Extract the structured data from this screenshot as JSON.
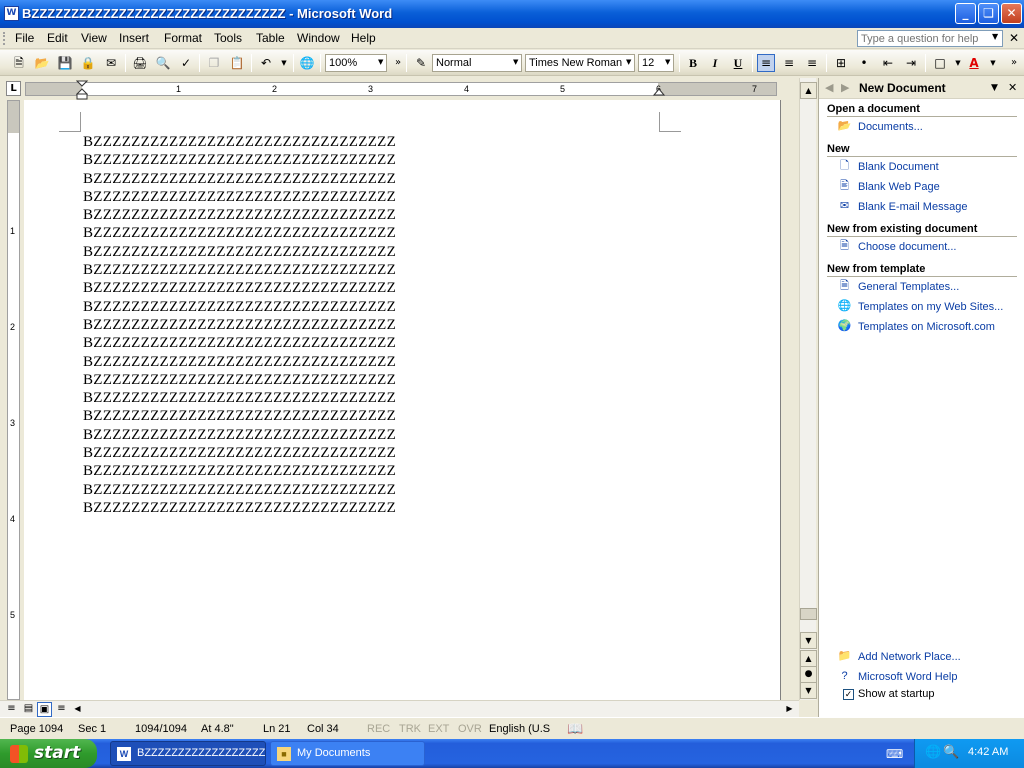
{
  "window": {
    "title": "BZZZZZZZZZZZZZZZZZZZZZZZZZZZZZZZZ - Microsoft Word",
    "app_icon": "W"
  },
  "menu": [
    "File",
    "Edit",
    "View",
    "Insert",
    "Format",
    "Tools",
    "Table",
    "Window",
    "Help"
  ],
  "help_search": {
    "placeholder": "Type a question for help"
  },
  "toolbar": {
    "zoom": "100%",
    "style": "Normal",
    "font": "Times New Roman",
    "size": "12",
    "bold_label": "B",
    "italic_label": "I",
    "underline_label": "U",
    "font_color_label": "A",
    "font_color": "#e00000"
  },
  "ruler": {
    "numbers": [
      "1",
      "2",
      "3",
      "4",
      "5",
      "6",
      "7"
    ],
    "vertical_numbers": [
      "1",
      "2",
      "3",
      "4",
      "5"
    ]
  },
  "document": {
    "lines": [
      "BZZZZZZZZZZZZZZZZZZZZZZZZZZZZZZZZ",
      "BZZZZZZZZZZZZZZZZZZZZZZZZZZZZZZZZ",
      "BZZZZZZZZZZZZZZZZZZZZZZZZZZZZZZZZ",
      "BZZZZZZZZZZZZZZZZZZZZZZZZZZZZZZZZ",
      "BZZZZZZZZZZZZZZZZZZZZZZZZZZZZZZZZ",
      "BZZZZZZZZZZZZZZZZZZZZZZZZZZZZZZZZ",
      "BZZZZZZZZZZZZZZZZZZZZZZZZZZZZZZZZ",
      "BZZZZZZZZZZZZZZZZZZZZZZZZZZZZZZZZ",
      "BZZZZZZZZZZZZZZZZZZZZZZZZZZZZZZZZ",
      "BZZZZZZZZZZZZZZZZZZZZZZZZZZZZZZZZ",
      "BZZZZZZZZZZZZZZZZZZZZZZZZZZZZZZZZ",
      "BZZZZZZZZZZZZZZZZZZZZZZZZZZZZZZZZ",
      "BZZZZZZZZZZZZZZZZZZZZZZZZZZZZZZZZ",
      "BZZZZZZZZZZZZZZZZZZZZZZZZZZZZZZZZ",
      "BZZZZZZZZZZZZZZZZZZZZZZZZZZZZZZZZ",
      "BZZZZZZZZZZZZZZZZZZZZZZZZZZZZZZZZ",
      "BZZZZZZZZZZZZZZZZZZZZZZZZZZZZZZZZ",
      "BZZZZZZZZZZZZZZZZZZZZZZZZZZZZZZZZ",
      "BZZZZZZZZZZZZZZZZZZZZZZZZZZZZZZZZ",
      "BZZZZZZZZZZZZZZZZZZZZZZZZZZZZZZZZ",
      "BZZZZZZZZZZZZZZZZZZZZZZZZZZZZZZZZ"
    ]
  },
  "taskpane": {
    "title": "New Document",
    "open_section": "Open a document",
    "open_documents": "Documents...",
    "new_section": "New",
    "blank_document": "Blank Document",
    "blank_web_page": "Blank Web Page",
    "blank_email": "Blank E-mail Message",
    "existing_section": "New from existing document",
    "choose_document": "Choose document...",
    "template_section": "New from template",
    "general_templates": "General Templates...",
    "web_templates": "Templates on my Web Sites...",
    "ms_templates": "Templates on Microsoft.com",
    "add_network_place": "Add Network Place...",
    "word_help": "Microsoft Word Help",
    "show_at_startup": "Show at startup",
    "show_at_startup_checked": true
  },
  "status": {
    "page": "Page 1094",
    "sec": "Sec 1",
    "pos": "1094/1094",
    "at": "At 4.8\"",
    "ln": "Ln 21",
    "col": "Col 34",
    "rec": "REC",
    "trk": "TRK",
    "ext": "EXT",
    "ovr": "OVR",
    "lang": "English (U.S"
  },
  "taskbar": {
    "start": "start",
    "word_task": "BZZZZZZZZZZZZZZZZZZ...",
    "mydocs_task": "My Documents",
    "clock": "4:42 AM"
  }
}
